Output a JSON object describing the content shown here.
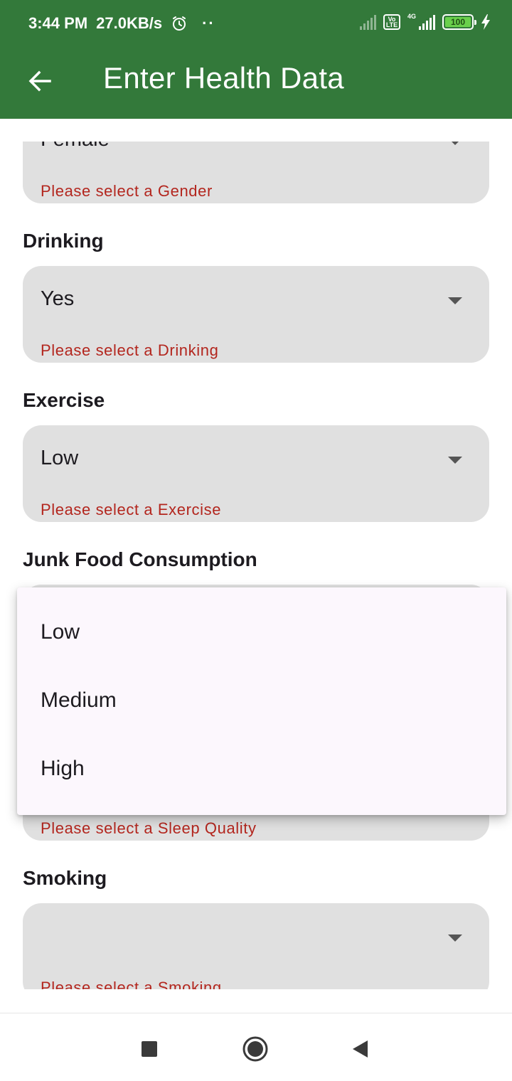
{
  "status_bar": {
    "time": "3:44 PM",
    "net_speed": "27.0KB/s",
    "dots": "··",
    "network_type": "4G",
    "volte_label": "Vo LTE",
    "battery_level": "100"
  },
  "app_bar": {
    "title": "Enter Health Data"
  },
  "form": {
    "gender": {
      "value": "Female",
      "error": "Please select a Gender"
    },
    "drinking": {
      "label": "Drinking",
      "value": "Yes",
      "error": "Please select a Drinking"
    },
    "exercise": {
      "label": "Exercise",
      "value": "Low",
      "error": "Please select a Exercise"
    },
    "junk_food": {
      "label": "Junk Food Consumption"
    },
    "sleep_quality": {
      "error": "Please select a Sleep Quality"
    },
    "smoking": {
      "label": "Smoking",
      "value": "",
      "error": "Please select a Smoking"
    }
  },
  "menu": {
    "options": [
      "Low",
      "Medium",
      "High"
    ]
  },
  "colors": {
    "primary": "#33793a",
    "field_bg": "#e0e0e0",
    "error": "#b3261e",
    "menu_bg": "#fcf7fd"
  }
}
